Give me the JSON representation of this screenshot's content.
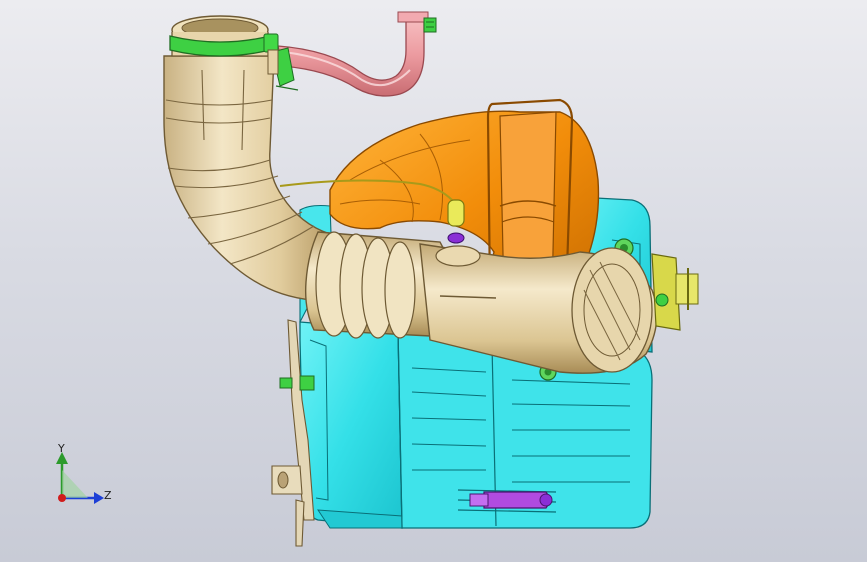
{
  "viewport": {
    "background_top": "#ececf0",
    "background_bottom": "#c8cbd6"
  },
  "model": {
    "parts": [
      "air-filter-housing",
      "intake-duct",
      "bellows-hose",
      "orange-inlet-scoop",
      "pink-breather-pipe",
      "green-hose-clamp",
      "mounting-bracket",
      "sensor-connector",
      "purple-clip"
    ],
    "colors": {
      "housing": "#35e0e8",
      "housing_edge": "#0a6f77",
      "duct": "#e6d3a8",
      "duct_edge": "#6e5a34",
      "scoop": "#f0900c",
      "scoop_edge": "#8a4a00",
      "pipe": "#f0a0a4",
      "clamp": "#3ed043",
      "clip": "#b04be0",
      "connector": "#d8d84a"
    }
  },
  "triad": {
    "y_label": "Y",
    "z_label": "Z",
    "y_color": "#2c9a2c",
    "z_color": "#1d3fd6",
    "origin_color": "#d01c1c"
  }
}
